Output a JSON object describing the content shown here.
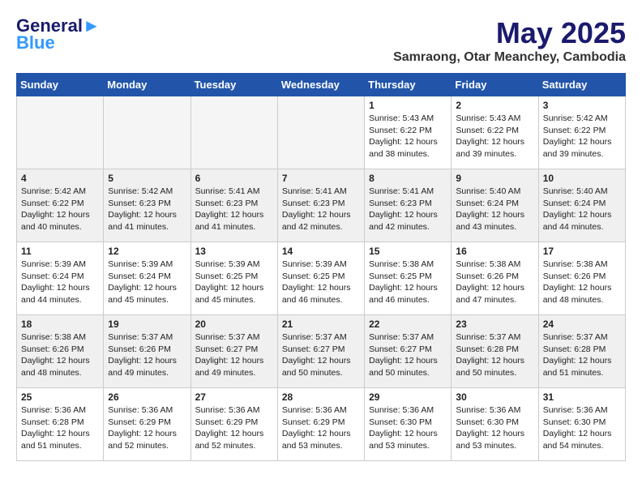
{
  "header": {
    "logo_line1": "General",
    "logo_line2": "Blue",
    "month": "May 2025",
    "location": "Samraong, Otar Meanchey, Cambodia"
  },
  "days_of_week": [
    "Sunday",
    "Monday",
    "Tuesday",
    "Wednesday",
    "Thursday",
    "Friday",
    "Saturday"
  ],
  "weeks": [
    [
      {
        "day": "",
        "info": "",
        "empty": true
      },
      {
        "day": "",
        "info": "",
        "empty": true
      },
      {
        "day": "",
        "info": "",
        "empty": true
      },
      {
        "day": "",
        "info": "",
        "empty": true
      },
      {
        "day": "1",
        "info": "Sunrise: 5:43 AM\nSunset: 6:22 PM\nDaylight: 12 hours\nand 38 minutes."
      },
      {
        "day": "2",
        "info": "Sunrise: 5:43 AM\nSunset: 6:22 PM\nDaylight: 12 hours\nand 39 minutes."
      },
      {
        "day": "3",
        "info": "Sunrise: 5:42 AM\nSunset: 6:22 PM\nDaylight: 12 hours\nand 39 minutes."
      }
    ],
    [
      {
        "day": "4",
        "info": "Sunrise: 5:42 AM\nSunset: 6:22 PM\nDaylight: 12 hours\nand 40 minutes."
      },
      {
        "day": "5",
        "info": "Sunrise: 5:42 AM\nSunset: 6:23 PM\nDaylight: 12 hours\nand 41 minutes."
      },
      {
        "day": "6",
        "info": "Sunrise: 5:41 AM\nSunset: 6:23 PM\nDaylight: 12 hours\nand 41 minutes."
      },
      {
        "day": "7",
        "info": "Sunrise: 5:41 AM\nSunset: 6:23 PM\nDaylight: 12 hours\nand 42 minutes."
      },
      {
        "day": "8",
        "info": "Sunrise: 5:41 AM\nSunset: 6:23 PM\nDaylight: 12 hours\nand 42 minutes."
      },
      {
        "day": "9",
        "info": "Sunrise: 5:40 AM\nSunset: 6:24 PM\nDaylight: 12 hours\nand 43 minutes."
      },
      {
        "day": "10",
        "info": "Sunrise: 5:40 AM\nSunset: 6:24 PM\nDaylight: 12 hours\nand 44 minutes."
      }
    ],
    [
      {
        "day": "11",
        "info": "Sunrise: 5:39 AM\nSunset: 6:24 PM\nDaylight: 12 hours\nand 44 minutes."
      },
      {
        "day": "12",
        "info": "Sunrise: 5:39 AM\nSunset: 6:24 PM\nDaylight: 12 hours\nand 45 minutes."
      },
      {
        "day": "13",
        "info": "Sunrise: 5:39 AM\nSunset: 6:25 PM\nDaylight: 12 hours\nand 45 minutes."
      },
      {
        "day": "14",
        "info": "Sunrise: 5:39 AM\nSunset: 6:25 PM\nDaylight: 12 hours\nand 46 minutes."
      },
      {
        "day": "15",
        "info": "Sunrise: 5:38 AM\nSunset: 6:25 PM\nDaylight: 12 hours\nand 46 minutes."
      },
      {
        "day": "16",
        "info": "Sunrise: 5:38 AM\nSunset: 6:26 PM\nDaylight: 12 hours\nand 47 minutes."
      },
      {
        "day": "17",
        "info": "Sunrise: 5:38 AM\nSunset: 6:26 PM\nDaylight: 12 hours\nand 48 minutes."
      }
    ],
    [
      {
        "day": "18",
        "info": "Sunrise: 5:38 AM\nSunset: 6:26 PM\nDaylight: 12 hours\nand 48 minutes."
      },
      {
        "day": "19",
        "info": "Sunrise: 5:37 AM\nSunset: 6:26 PM\nDaylight: 12 hours\nand 49 minutes."
      },
      {
        "day": "20",
        "info": "Sunrise: 5:37 AM\nSunset: 6:27 PM\nDaylight: 12 hours\nand 49 minutes."
      },
      {
        "day": "21",
        "info": "Sunrise: 5:37 AM\nSunset: 6:27 PM\nDaylight: 12 hours\nand 50 minutes."
      },
      {
        "day": "22",
        "info": "Sunrise: 5:37 AM\nSunset: 6:27 PM\nDaylight: 12 hours\nand 50 minutes."
      },
      {
        "day": "23",
        "info": "Sunrise: 5:37 AM\nSunset: 6:28 PM\nDaylight: 12 hours\nand 50 minutes."
      },
      {
        "day": "24",
        "info": "Sunrise: 5:37 AM\nSunset: 6:28 PM\nDaylight: 12 hours\nand 51 minutes."
      }
    ],
    [
      {
        "day": "25",
        "info": "Sunrise: 5:36 AM\nSunset: 6:28 PM\nDaylight: 12 hours\nand 51 minutes."
      },
      {
        "day": "26",
        "info": "Sunrise: 5:36 AM\nSunset: 6:29 PM\nDaylight: 12 hours\nand 52 minutes."
      },
      {
        "day": "27",
        "info": "Sunrise: 5:36 AM\nSunset: 6:29 PM\nDaylight: 12 hours\nand 52 minutes."
      },
      {
        "day": "28",
        "info": "Sunrise: 5:36 AM\nSunset: 6:29 PM\nDaylight: 12 hours\nand 53 minutes."
      },
      {
        "day": "29",
        "info": "Sunrise: 5:36 AM\nSunset: 6:30 PM\nDaylight: 12 hours\nand 53 minutes."
      },
      {
        "day": "30",
        "info": "Sunrise: 5:36 AM\nSunset: 6:30 PM\nDaylight: 12 hours\nand 53 minutes."
      },
      {
        "day": "31",
        "info": "Sunrise: 5:36 AM\nSunset: 6:30 PM\nDaylight: 12 hours\nand 54 minutes."
      }
    ]
  ]
}
